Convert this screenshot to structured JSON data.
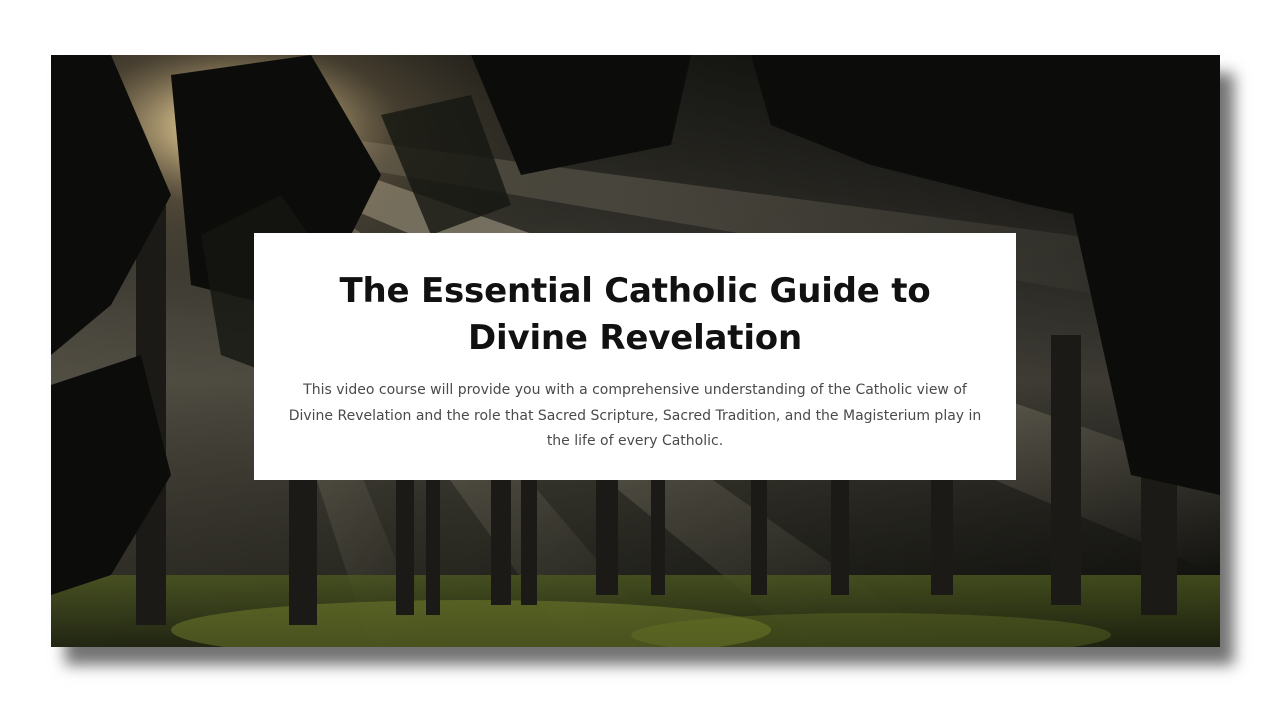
{
  "hero": {
    "background_image": "sunlit-forest-with-light-rays",
    "title": "The Essential Catholic Guide to Divine Revelation",
    "description": "This video course will provide you with a comprehensive understanding of the Catholic view of Divine Revelation and the role that Sacred Scripture, Sacred Tradition, and the Magisterium play in the life of every Catholic."
  },
  "colors": {
    "card_background": "#ffffff",
    "title_color": "#111111",
    "description_color": "#4a4a4a"
  }
}
